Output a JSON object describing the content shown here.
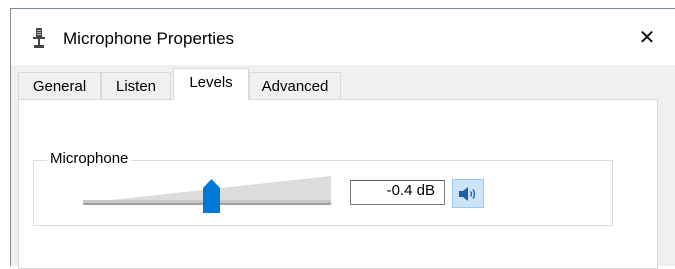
{
  "dialog": {
    "title": "Microphone Properties",
    "close_symbol": "✕",
    "icon": "microphone-icon"
  },
  "tabs": [
    {
      "label": "General",
      "active": false
    },
    {
      "label": "Listen",
      "active": false
    },
    {
      "label": "Levels",
      "active": true
    },
    {
      "label": "Advanced",
      "active": false
    }
  ],
  "levels": {
    "group_label": "Microphone",
    "level_fraction": 0.52,
    "db_value": "-0.4 dB",
    "mute_icon": "speaker-volume-icon"
  },
  "colors": {
    "accent": "#0078d7",
    "mute_bg": "#cce4f7",
    "track": "#dcdcdc"
  }
}
